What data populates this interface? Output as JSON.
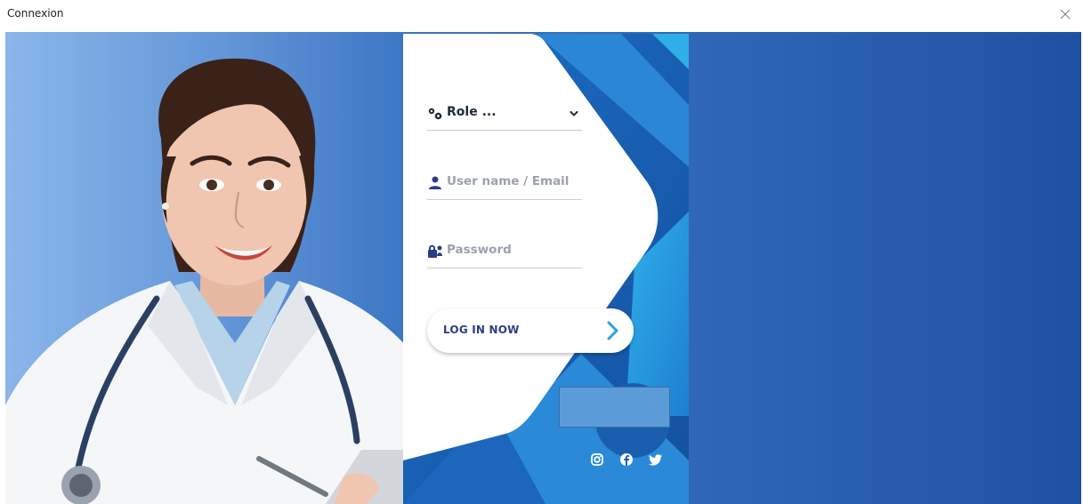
{
  "window": {
    "title": "Connexion",
    "close_icon": "close-icon"
  },
  "form": {
    "role_label": "Role ...",
    "username_placeholder": "User name / Email",
    "password_placeholder": "Password",
    "login_label": "LOG IN NOW"
  },
  "icons": {
    "role": "gears-icon",
    "user": "user-icon",
    "password": "user-lock-icon",
    "dropdown": "chevron-down-icon",
    "login_arrow": "chevron-right-icon",
    "social": [
      "instagram-icon",
      "facebook-icon",
      "twitter-icon"
    ]
  },
  "colors": {
    "accent": "#2a3e86",
    "card_blue": "#1b5fb5",
    "light_blue": "#2aa3e0",
    "placeholder": "#9aa1ad"
  }
}
